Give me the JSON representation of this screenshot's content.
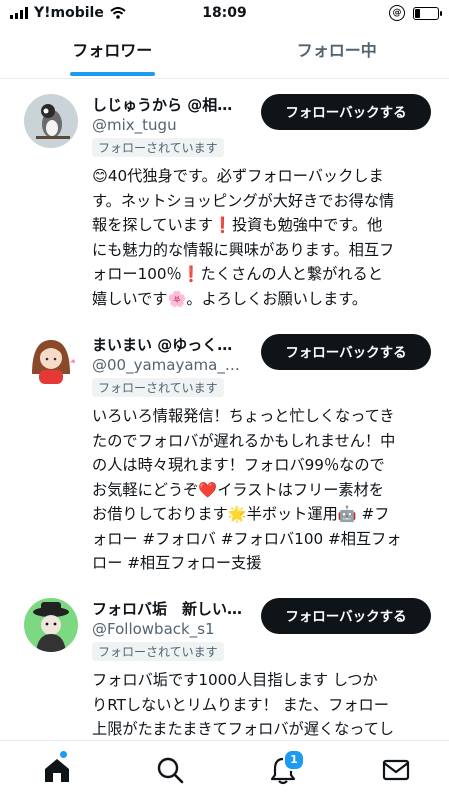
{
  "status_bar": {
    "carrier": "Y!mobile",
    "time": "18:09",
    "orientation_lock": "@"
  },
  "tabs": [
    {
      "label": "フォロワー",
      "active": true
    },
    {
      "label": "フォロー中",
      "active": false
    }
  ],
  "users": [
    {
      "name": "しじゅうから @相…",
      "handle": "@mix_tugu",
      "badge": "フォローされています",
      "button": "フォローバックする",
      "bio": "😊40代独身です。必ずフォローバックしま\nす。ネットショッピングが大好きでお得な情\n報を探しています❗投資も勉強中です。他\nにも魅力的な情報に興味があります。相互フ\nォロー100％❗たくさんの人と繋がれると\n嬉しいです🌸。よろしくお願いします。"
    },
    {
      "name": "まいまい @ゆっく…",
      "handle": "@00_yamayama_…",
      "badge": "フォローされています",
      "button": "フォローバックする",
      "bio": "いろいろ情報発信！ちょっと忙しくなってき\nたのでフォロバが遅れるかもしれません！中\nの人は時々現れます！フォロバ99％なので\nお気軽にどうぞ❤️イラストはフリー素材を\nお借りしております🌟半ボット運用🤖 #フ\nォロー #フォロバ #フォロバ100 #相互フォ\nロー #相互フォロー支援"
    },
    {
      "name": "フォロバ垢　新しい…",
      "handle": "@Followback_s1",
      "badge": "フォローされています",
      "button": "フォローバックする",
      "bio": "フォロバ垢です1000人目指します しつか\nりRTしないとリムります！ また、フォロー\n上限がたまたまきてフォロバが遅くなってし"
    }
  ],
  "bottom_nav": {
    "items": [
      "home-icon",
      "search-icon",
      "bell-icon",
      "mail-icon"
    ],
    "notification_count": "1"
  },
  "colors": {
    "accent": "#1d9bf0",
    "button_bg": "#0f1419",
    "secondary_text": "#536471"
  }
}
